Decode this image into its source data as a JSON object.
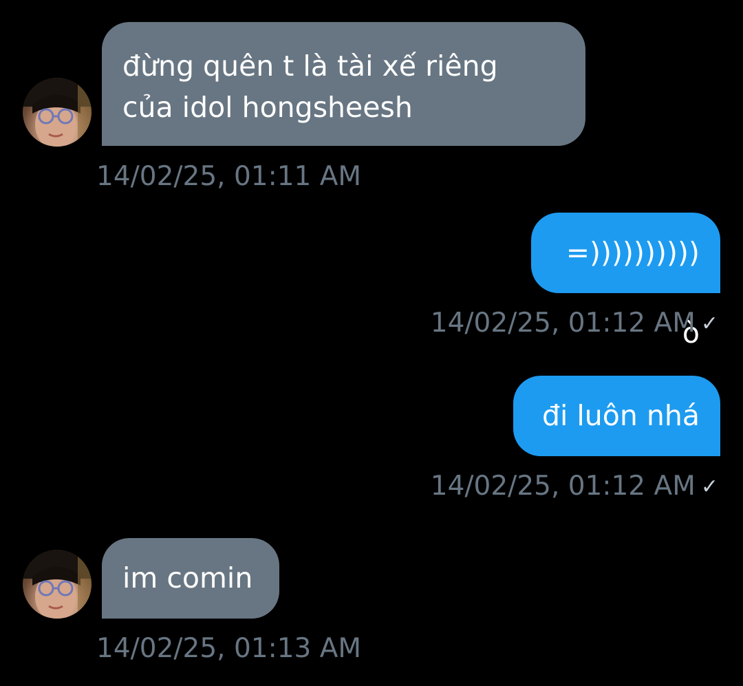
{
  "messages": [
    {
      "direction": "incoming",
      "text": "đừng quên t là tài xế riêng\ncủa idol hongsheesh",
      "timestamp": "14/02/25, 01:11 AM"
    },
    {
      "direction": "outgoing",
      "text": "=)))))))))) ò",
      "timestamp": "14/02/25, 01:12 AM",
      "status_icon": "✓"
    },
    {
      "direction": "outgoing",
      "text": "đi luôn nhá",
      "timestamp": "14/02/25, 01:12 AM",
      "status_icon": "✓"
    },
    {
      "direction": "incoming",
      "text": "im comin",
      "timestamp": "14/02/25, 01:13 AM"
    }
  ],
  "colors": {
    "background": "#000000",
    "incoming_bubble": "#687683",
    "outgoing_bubble": "#1d9bf0",
    "timestamp_text": "#687683",
    "bubble_text": "#ffffff"
  },
  "icons": {
    "read_receipt": "check-icon",
    "sender_avatar": "avatar"
  }
}
